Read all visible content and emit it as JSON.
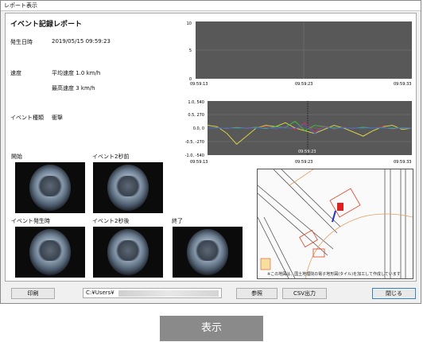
{
  "window": {
    "title": "レポート表示"
  },
  "report": {
    "title": "イベント記録レポート",
    "date_label": "発生日時",
    "date_value": "2019/05/15 09:59:23",
    "speed_label": "速度",
    "avg_speed": "平均速度 1.0 km/h",
    "max_speed": "最高速度 3 km/h",
    "event_type_label": "イベント種類",
    "event_type_value": "衝撃"
  },
  "cameras": {
    "start": "開始",
    "before2s": "イベント2秒前",
    "event": "イベント発生時",
    "after2s": "イベント2秒後",
    "end": "終了"
  },
  "speed_chart": {
    "y_ticks": [
      "10",
      "5",
      "0"
    ],
    "x_ticks": [
      "09:59:13",
      "09:59:23",
      "09:59:33"
    ]
  },
  "accel_chart": {
    "y_ticks": [
      "1.0, 540",
      "0.5, 270",
      "0.0, 0",
      "-0.5, -270",
      "-1.0, -540"
    ],
    "x_ticks": [
      "09:59:13",
      "09:59:23",
      "09:59:33"
    ],
    "cursor_label": "09:59:23"
  },
  "chart_data": [
    {
      "type": "line",
      "title": "",
      "x": [
        "09:59:13",
        "09:59:23",
        "09:59:33"
      ],
      "ylim": [
        0,
        10
      ],
      "series": [
        {
          "values": []
        }
      ]
    },
    {
      "type": "line",
      "title": "",
      "x": [
        "09:59:13",
        "09:59:23",
        "09:59:33"
      ],
      "ylim": [
        -1.0,
        1.0
      ],
      "series": [
        {
          "color": "#e8e040",
          "values": [
            0.1,
            0.05,
            -0.2,
            -0.6,
            -0.3,
            0.0,
            0.1,
            0.05,
            0.2,
            0.0,
            -0.1,
            -0.2,
            -0.05,
            0.1,
            0.0,
            -0.15,
            -0.3,
            -0.1,
            0.05,
            0.1,
            -0.05,
            0.0
          ]
        },
        {
          "color": "#e23030",
          "values": [
            0.0,
            0.02,
            -0.02,
            0.03,
            -0.02,
            0.01,
            0.05,
            -0.04,
            0.06,
            -0.05,
            0.2,
            -0.15,
            0.08,
            -0.05,
            0.03,
            -0.02,
            0.02,
            0.0,
            0.04,
            -0.03,
            0.01,
            0.0
          ]
        },
        {
          "color": "#40c040",
          "values": [
            0.0,
            0.01,
            -0.01,
            0.02,
            0.0,
            0.03,
            -0.02,
            0.05,
            0.02,
            0.25,
            -0.1,
            0.1,
            0.05,
            0.0,
            0.02,
            -0.01,
            0.03,
            0.0,
            0.02,
            -0.02,
            0.01,
            0.0
          ]
        },
        {
          "color": "#4060e0",
          "values": [
            0.0,
            -0.01,
            0.01,
            -0.02,
            0.01,
            0.0,
            0.02,
            -0.03,
            0.04,
            -0.02,
            0.15,
            -0.2,
            0.05,
            -0.03,
            0.02,
            0.0,
            -0.01,
            0.01,
            0.0,
            0.02,
            -0.01,
            0.0
          ]
        }
      ]
    }
  ],
  "map": {
    "note": "※この地図は、国土地理院の電子地形図(タイル)を加工して作成しています",
    "marker_color": "#e02020",
    "track_color": "#2030c0"
  },
  "buttons": {
    "print": "印刷",
    "browse": "参照",
    "csv": "CSV出力",
    "close": "閉じる",
    "display": "表示"
  },
  "path": {
    "value": "C:¥Users¥"
  }
}
